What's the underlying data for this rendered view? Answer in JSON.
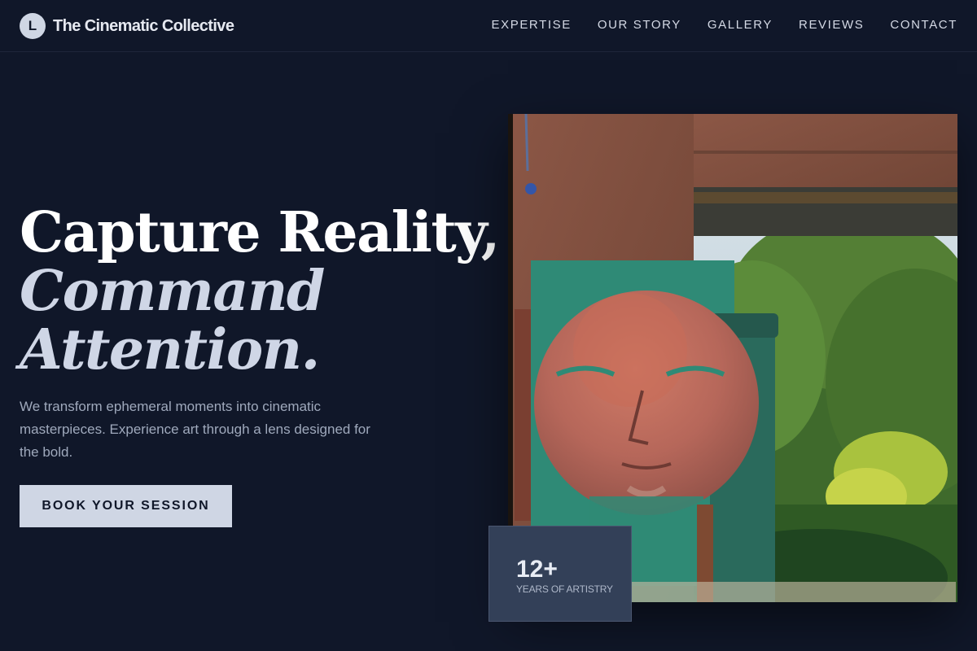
{
  "brand": {
    "logo_letter": "L",
    "name": "The Cinematic Collective"
  },
  "nav": {
    "items": [
      {
        "label": "EXPERTISE"
      },
      {
        "label": "OUR STORY"
      },
      {
        "label": "GALLERY"
      },
      {
        "label": "REVIEWS"
      },
      {
        "label": "CONTACT"
      }
    ]
  },
  "hero": {
    "title_line1": "Capture Reality,",
    "title_line2": "Command",
    "title_line3": "Attention.",
    "description": "We transform ephemeral moments into cinematic masterpieces. Experience art through a lens designed for the bold.",
    "cta_label": "BOOK YOUR SESSION"
  },
  "stat": {
    "value": "12+",
    "label": "YEARS OF ARTISTRY"
  },
  "colors": {
    "background": "#101729",
    "accent": "#cfd6e4",
    "card": "#334058"
  },
  "icons": {
    "logo": "letter-logo-icon"
  }
}
